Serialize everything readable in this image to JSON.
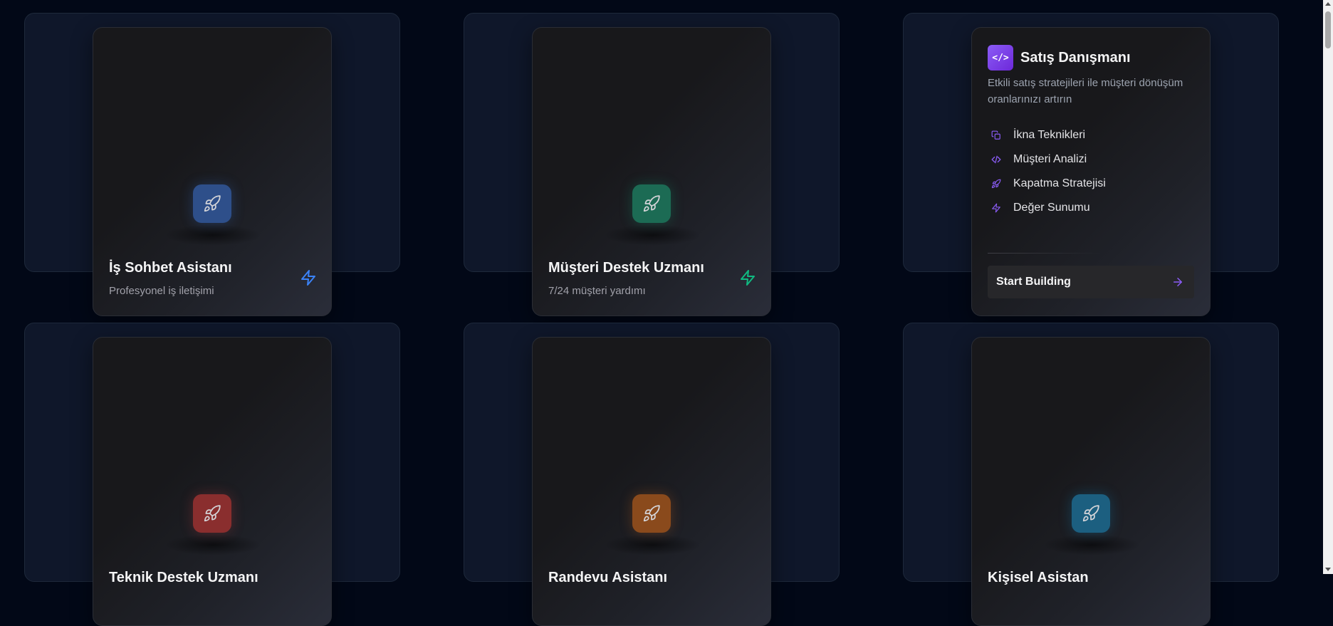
{
  "cards": [
    {
      "title": "İş Sohbet Asistanı",
      "subtitle": "Profesyonel iş iletişimi",
      "icon": "rocket-icon",
      "accent": "#3b82f6",
      "icon_bg": "#2e4f8a"
    },
    {
      "title": "Müşteri Destek Uzmanı",
      "subtitle": "7/24 müşteri yardımı",
      "icon": "rocket-icon",
      "accent": "#10b981",
      "icon_bg": "#1c6b54"
    },
    {
      "title": "Satış Danışmanı",
      "subtitle": "Etkili satış stratejileri ile müşteri dönüşüm oranlarınızı artırın",
      "icon": "code-icon",
      "accent": "#8b5cf6",
      "expanded": true,
      "features": [
        {
          "icon": "copy-icon",
          "label": "İkna Teknikleri"
        },
        {
          "icon": "code-icon",
          "label": "Müşteri Analizi"
        },
        {
          "icon": "rocket-icon",
          "label": "Kapatma Stratejisi"
        },
        {
          "icon": "bolt-icon",
          "label": "Değer Sunumu"
        }
      ],
      "cta_label": "Start Building"
    },
    {
      "title": "Teknik Destek Uzmanı",
      "subtitle": "",
      "icon": "rocket-icon",
      "accent": "#ef4444",
      "icon_bg": "#8a2e2e"
    },
    {
      "title": "Randevu Asistanı",
      "subtitle": "",
      "icon": "rocket-icon",
      "accent": "#f97316",
      "icon_bg": "#8a4a1c"
    },
    {
      "title": "Kişisel Asistan",
      "subtitle": "",
      "icon": "rocket-icon",
      "accent": "#0ea5e9",
      "icon_bg": "#1c5f80"
    }
  ]
}
